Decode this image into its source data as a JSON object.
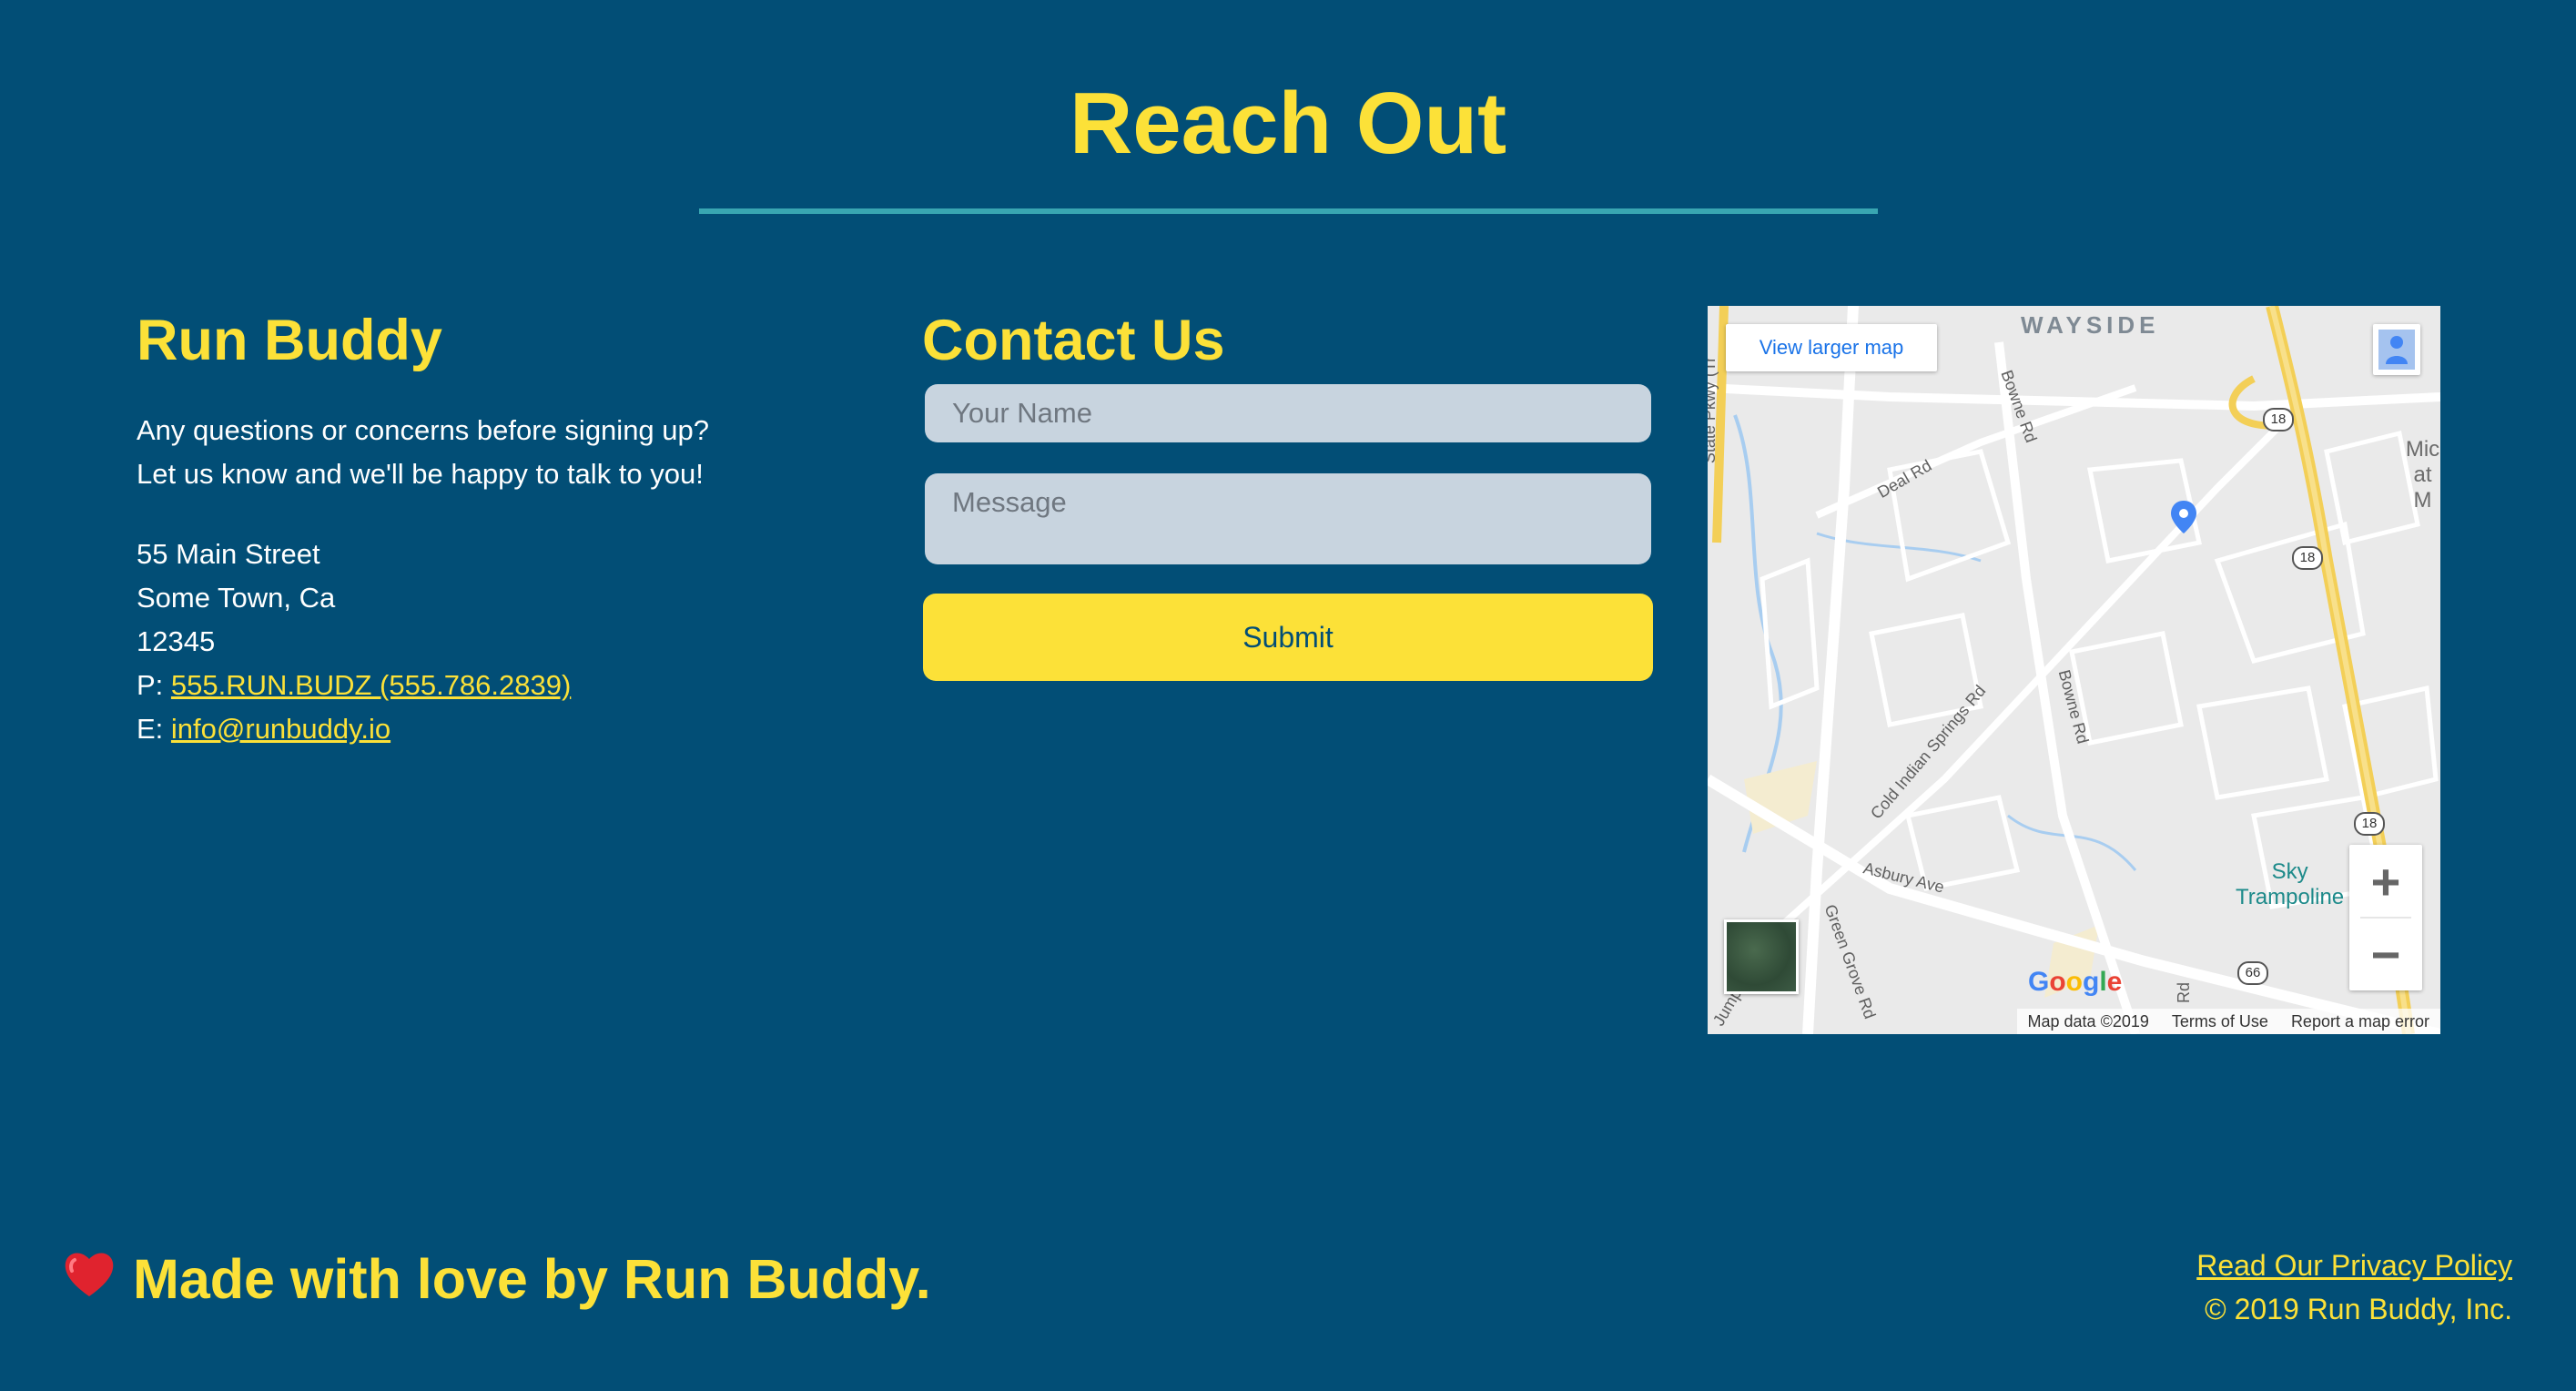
{
  "header": {
    "title": "Reach Out"
  },
  "about": {
    "heading": "Run Buddy",
    "intro_line1": "Any questions or concerns before signing up?",
    "intro_line2": "Let us know and we'll be happy to talk to you!",
    "address_line1": "55 Main Street",
    "address_line2": "Some Town, Ca",
    "address_line3": "12345",
    "phone_prefix": "P:",
    "phone_link": "555.RUN.BUDZ (555.786.2839)",
    "email_prefix": "E:",
    "email_link": "info@runbuddy.io"
  },
  "contact": {
    "heading": "Contact Us",
    "name_placeholder": "Your Name",
    "message_placeholder": "Message",
    "submit_label": "Submit"
  },
  "map": {
    "view_larger": "View larger map",
    "area_label": "WAYSIDE",
    "street_labels": {
      "deal_rd": "Deal Rd",
      "bowne_rd_top": "Bowne Rd",
      "bowne_rd_mid": "Bowne Rd",
      "cold_indian": "Cold Indian Springs Rd",
      "asbury": "Asbury Ave",
      "green_grove": "Green Grove Rd",
      "state_pkwy": "State Pkwy (Tr",
      "rd_bottom": "Rd",
      "jump": "Jump"
    },
    "route_shields": [
      "18",
      "18",
      "18",
      "66"
    ],
    "poi_label_line1": "Sky",
    "poi_label_line2": "Trampoline",
    "edge_label_line1": "Mic",
    "edge_label_line2": "at M",
    "zoom_in": "+",
    "zoom_out": "−",
    "google": "Google",
    "footer_data": "Map data ©2019",
    "footer_terms": "Terms of Use",
    "footer_report": "Report a map error"
  },
  "footer": {
    "made_with": "Made with love by Run Buddy.",
    "privacy_link": "Read Our Privacy Policy",
    "copyright": "© 2019 Run Buddy, Inc."
  },
  "colors": {
    "background": "#024e76",
    "accent": "#fce138",
    "rule": "#39a6b2"
  }
}
